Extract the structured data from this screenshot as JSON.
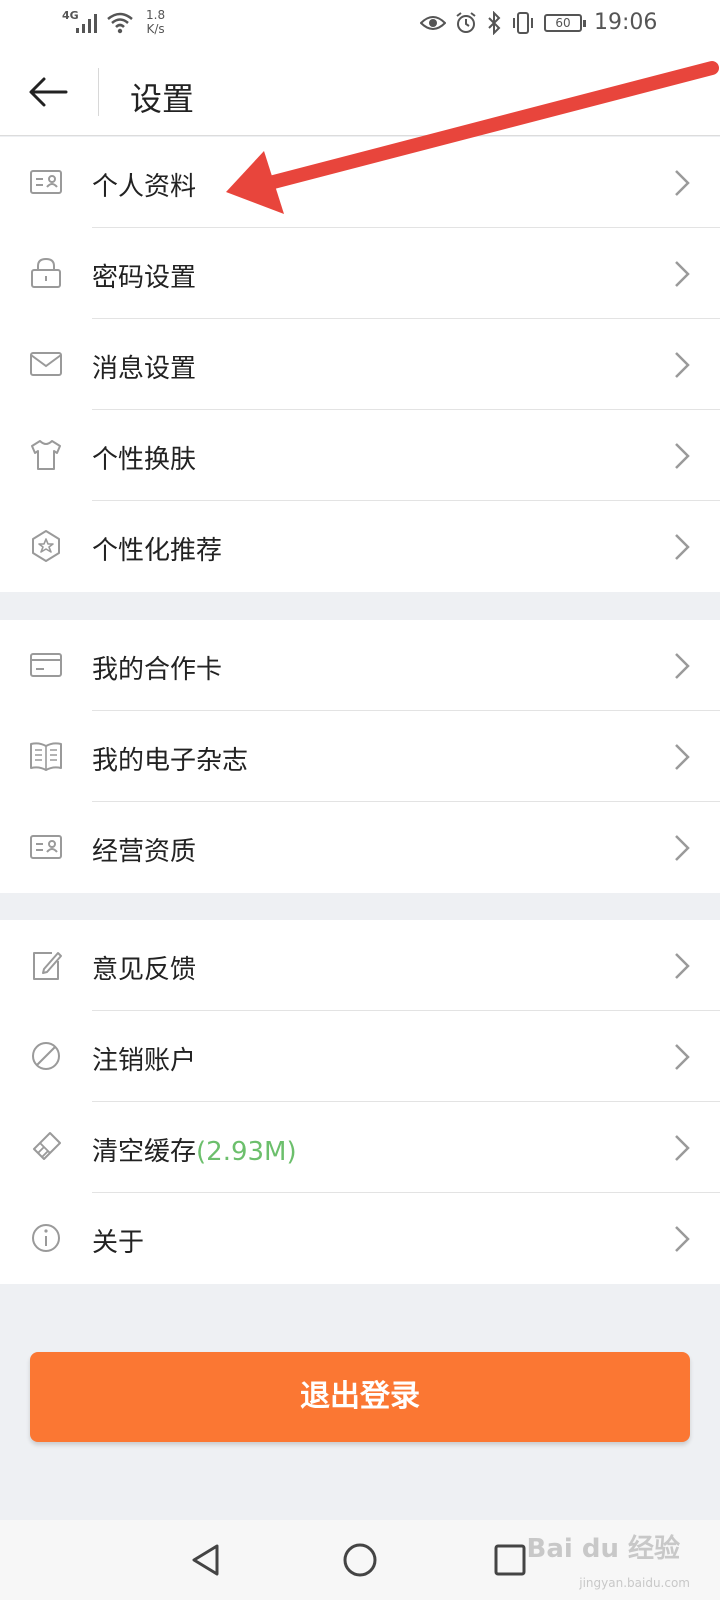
{
  "status_bar": {
    "network": "4G",
    "speed_value": "1.8",
    "speed_unit": "K/s",
    "battery": "60",
    "time": "19:06"
  },
  "header": {
    "title": "设置"
  },
  "groups": [
    [
      {
        "label": "个人资料",
        "icon": "id-card-icon"
      },
      {
        "label": "密码设置",
        "icon": "lock-icon"
      },
      {
        "label": "消息设置",
        "icon": "envelope-icon"
      },
      {
        "label": "个性换肤",
        "icon": "shirt-icon"
      },
      {
        "label": "个性化推荐",
        "icon": "star-badge-icon"
      }
    ],
    [
      {
        "label": "我的合作卡",
        "icon": "card-icon"
      },
      {
        "label": "我的电子杂志",
        "icon": "book-icon"
      },
      {
        "label": "经营资质",
        "icon": "id-card-icon"
      }
    ],
    [
      {
        "label": "意见反馈",
        "icon": "edit-icon"
      },
      {
        "label": "注销账户",
        "icon": "ban-icon"
      },
      {
        "label": "清空缓存",
        "extra": "(2.93M)",
        "icon": "broom-icon"
      },
      {
        "label": "关于",
        "icon": "info-icon"
      }
    ]
  ],
  "logout_label": "退出登录",
  "watermark": {
    "brand": "Bai du 经验",
    "site": "jingyan.baidu.com"
  },
  "colors": {
    "accent": "#fb7733",
    "cache_size": "#6cbf6c",
    "annotation_arrow": "#e8453c"
  }
}
